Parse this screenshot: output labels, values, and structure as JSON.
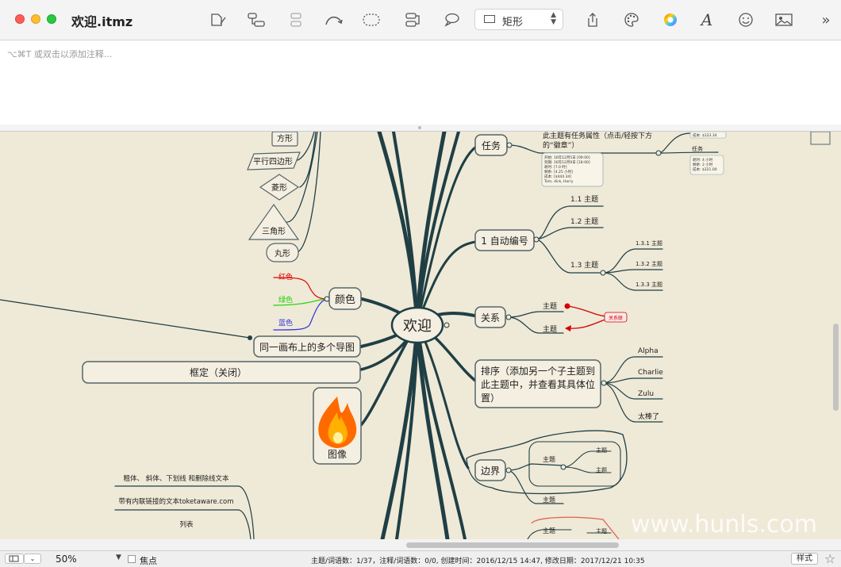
{
  "window": {
    "title": "欢迎.itmz"
  },
  "toolbar": {
    "shape_label": "矩形",
    "icons": [
      "note-icon",
      "topic-link-icon",
      "subtopic-icon",
      "relation-icon",
      "boundary-icon",
      "callout-icon",
      "comment-icon",
      "share-icon",
      "palette-icon",
      "color-wheel-icon",
      "font-icon",
      "emoji-icon",
      "image-icon",
      "more-icon"
    ]
  },
  "notes": {
    "placeholder": "⌥⌘T 或双击以添加注释..."
  },
  "map": {
    "central": "欢迎",
    "shapes": [
      "方形",
      "平行四边形",
      "菱形",
      "三角形",
      "丸形"
    ],
    "colors": {
      "parent": "颜色",
      "red": "红色",
      "green": "绿色",
      "blue": "蓝色"
    },
    "multi_maps": "同一画布上的多个导图",
    "boundary_closed": "框定（关闭）",
    "image_label": "图像",
    "text_styles": {
      "rich": "粗体、 斜体、下划线 和删除线文本",
      "link": "带有内联链接的文本toketaware.com",
      "list": "列表"
    },
    "task": {
      "label": "任务",
      "desc_line1": "此主题有任务属性（点击/轻按下方",
      "desc_line2": "的“徽章”）",
      "sub": "任务",
      "badge_lines": [
        "开始: 16年12月5日 [09:00]",
        "到期: 16年12月9日 [18:00]",
        "耗时: [7.0 时]",
        "剩余: [4.25 小时]",
        "成本: [$444.34]",
        "Tom, dick, Harry"
      ],
      "right_badge1": [
        "成本: $123.34"
      ],
      "right_badge2": [
        "耗时: 4 小时",
        "剩余: 2 小时",
        "成本: $321.00"
      ]
    },
    "auto_number": {
      "label": "1 自动编号",
      "items": [
        "1.1 主题",
        "1.2 主题",
        "1.3 主题"
      ],
      "sub_items": [
        "1.3.1 主题",
        "1.3.2 主题",
        "1.3.3 主题"
      ]
    },
    "relation": {
      "label": "关系",
      "topic1": "主题",
      "topic2": "主题",
      "rel_label": "关系联"
    },
    "sorting": {
      "lines": [
        "排序（添加另一个子主题到",
        "此主题中，并查看其具体位",
        "置）"
      ],
      "items": [
        "Alpha",
        "Charlie",
        "Zulu",
        "太棒了"
      ]
    },
    "boundary": {
      "label": "边界",
      "group": "主题",
      "group_children": [
        "主题",
        "主题"
      ],
      "other": "主题"
    },
    "bottom_topics": [
      "主题",
      "主题"
    ]
  },
  "status": {
    "zoom": "50%",
    "focus_label": "焦点",
    "info": "主题/词语数：1/37，注释/词语数：0/0, 创建时间：2016/12/15 14:47, 修改日期：2017/12/21 10:35",
    "style_btn": "样式"
  },
  "watermark": "www.hunls.com",
  "colors": {
    "accent_red": "#d40000",
    "branch": "#1f3f45",
    "canvas": "#efe9d7"
  }
}
